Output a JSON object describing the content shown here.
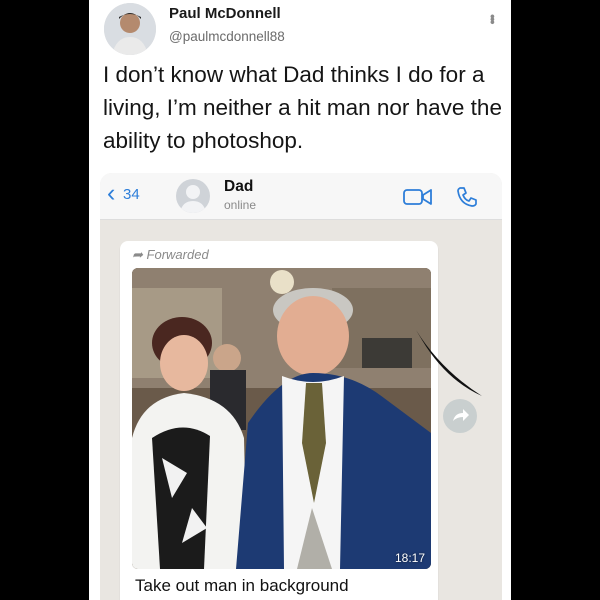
{
  "tweet": {
    "author": "Paul McDonnell",
    "handle": "@paulmcdonnell88",
    "text": "I don’t know what Dad thinks I do for a living, I’m neither a hit man nor have the ability to photoshop."
  },
  "chat": {
    "unread_count": "34",
    "contact_name": "Dad",
    "contact_status": "online",
    "message": {
      "forwarded_label": "Forwarded",
      "time": "18:17",
      "caption": "Take out man in background"
    }
  },
  "icons": [
    "avatar",
    "more-icon",
    "back-chevron-icon",
    "video-call-icon",
    "phone-icon",
    "forward-arrow-icon",
    "share-icon"
  ],
  "colors": {
    "ios_blue": "#2d7ed9",
    "chat_bg": "#e9e6e1",
    "bubble": "#ffffff"
  }
}
